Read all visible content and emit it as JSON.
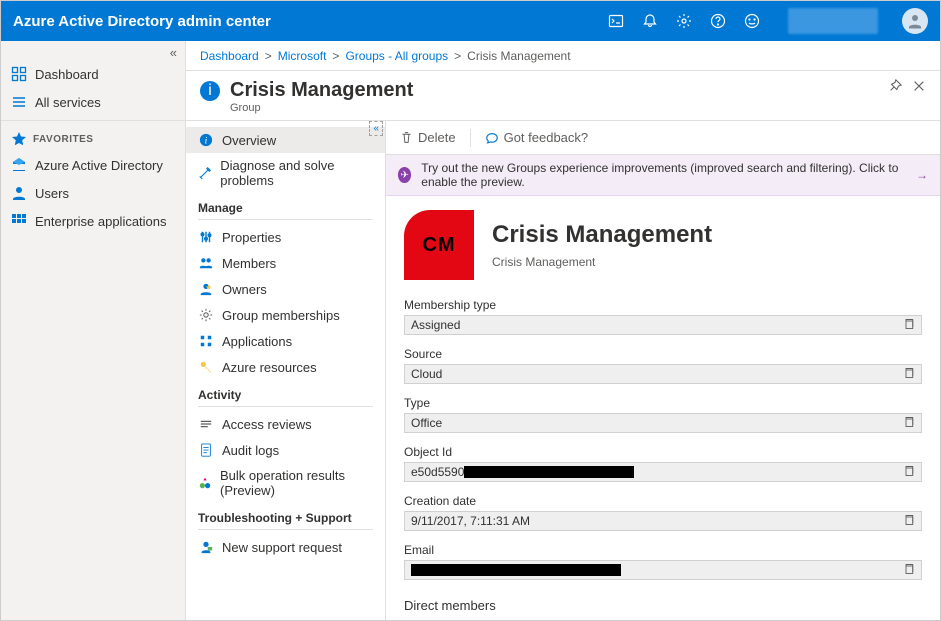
{
  "brand": "Azure Active Directory admin center",
  "breadcrumb": [
    {
      "label": "Dashboard",
      "link": true
    },
    {
      "label": "Microsoft",
      "link": true
    },
    {
      "label": "Groups - All groups",
      "link": true
    },
    {
      "label": "Crisis Management",
      "link": false
    }
  ],
  "page": {
    "title": "Crisis Management",
    "subtitle": "Group"
  },
  "left": [
    {
      "icon": "dashboard",
      "label": "Dashboard"
    },
    {
      "icon": "allservices",
      "label": "All services"
    }
  ],
  "favorites_label": "FAVORITES",
  "favorites": [
    {
      "icon": "aad",
      "label": "Azure Active Directory"
    },
    {
      "icon": "users",
      "label": "Users"
    },
    {
      "icon": "apps",
      "label": "Enterprise applications"
    }
  ],
  "subnav_collapse": "«",
  "subnav": [
    {
      "type": "item",
      "icon": "overview",
      "label": "Overview",
      "selected": true
    },
    {
      "type": "item",
      "icon": "diagnose",
      "label": "Diagnose and solve problems"
    },
    {
      "type": "section",
      "label": "Manage"
    },
    {
      "type": "item",
      "icon": "properties",
      "label": "Properties"
    },
    {
      "type": "item",
      "icon": "members",
      "label": "Members"
    },
    {
      "type": "item",
      "icon": "owners",
      "label": "Owners"
    },
    {
      "type": "item",
      "icon": "gear",
      "label": "Group memberships"
    },
    {
      "type": "item",
      "icon": "apps2",
      "label": "Applications"
    },
    {
      "type": "item",
      "icon": "key",
      "label": "Azure resources"
    },
    {
      "type": "section",
      "label": "Activity"
    },
    {
      "type": "item",
      "icon": "access",
      "label": "Access reviews"
    },
    {
      "type": "item",
      "icon": "audit",
      "label": "Audit logs"
    },
    {
      "type": "item",
      "icon": "bulk",
      "label": "Bulk operation results (Preview)"
    },
    {
      "type": "section",
      "label": "Troubleshooting + Support"
    },
    {
      "type": "item",
      "icon": "support",
      "label": "New support request"
    }
  ],
  "toolbar": {
    "delete": "Delete",
    "feedback": "Got feedback?"
  },
  "banner": "Try out the new Groups experience improvements (improved search and filtering). Click to enable the preview.",
  "hero": {
    "initials": "CM",
    "title": "Crisis Management",
    "subtitle": "Crisis Management"
  },
  "fields": [
    {
      "label": "Membership type",
      "value": "Assigned",
      "redactedWidth": 0
    },
    {
      "label": "Source",
      "value": "Cloud",
      "redactedWidth": 0
    },
    {
      "label": "Type",
      "value": "Office",
      "redactedWidth": 0
    },
    {
      "label": "Object Id",
      "value": "e50d5590",
      "redactedWidth": 170
    },
    {
      "label": "Creation date",
      "value": "9/11/2017, 7:11:31 AM",
      "redactedWidth": 0
    },
    {
      "label": "Email",
      "value": "",
      "redactedWidth": 210
    }
  ],
  "direct_members": "Direct members"
}
